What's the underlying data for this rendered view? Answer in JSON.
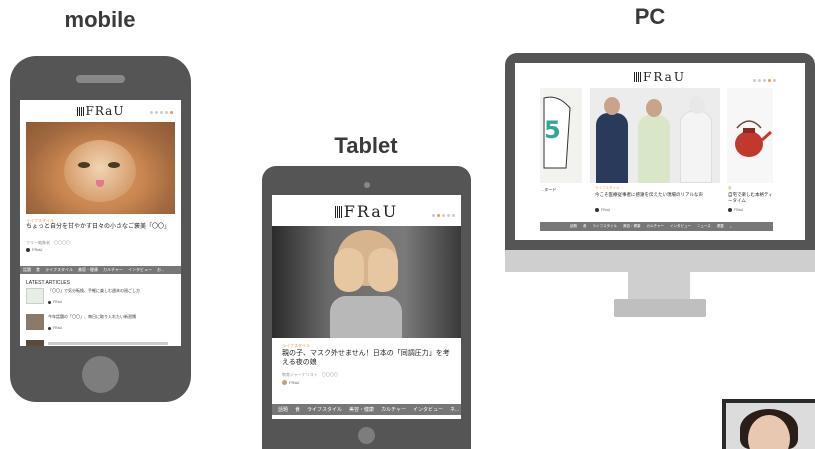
{
  "labels": {
    "mobile": "mobile",
    "tablet": "Tablet",
    "pc": "PC"
  },
  "site": {
    "logo_text": "FRaU"
  },
  "mobile": {
    "category": "ライフスタイル",
    "article_title": "ちょっと自分を甘やかす日々の小さなご褒美「〇〇」",
    "article_sub": "フリー編集者　〇〇〇〇",
    "author": "FRaU",
    "nav": [
      "話題",
      "食",
      "ライフスタイル",
      "美容・健康",
      "カルチャー",
      "インタビュー",
      "お..."
    ],
    "section_heading": "LATEST ARTICLES",
    "list": [
      {
        "title": "「〇〇」で気分転換、手軽に楽しむ週末の過ごし方",
        "author": "FRaU"
      },
      {
        "title": "今年話題の「〇〇」、毎日に取り入れたい新習慣",
        "author": "FRaU"
      }
    ]
  },
  "tablet": {
    "category": "ライフスタイル",
    "article_title": "親の子、マスク外せません！日本の「同調圧力」を考える夜の娘",
    "article_sub": "教育ジャーナリスト　〇〇〇〇",
    "author": "FRaU",
    "nav": [
      "話題",
      "食",
      "ライフスタイル",
      "美容・健康",
      "カルチャー",
      "インタビュー",
      "ネ..."
    ]
  },
  "pc": {
    "left_caption": "...ヌード",
    "center_category": "ライフスタイル",
    "center_title": "今こそ医療従事者に感謝を伝えたい現場のリアルな声",
    "center_author": "FRaU",
    "right_category": "食",
    "right_title": "自宅で楽しむ本格ティータイム",
    "right_author": "FRaU",
    "nav": [
      "話題",
      "食",
      "ライフスタイル",
      "美容・健康",
      "カルチャー",
      "インタビュー",
      "ニュース",
      "連載"
    ]
  },
  "colors": {
    "device_body": "#555555",
    "accent": "#e0a050",
    "navbar": "#777777"
  }
}
